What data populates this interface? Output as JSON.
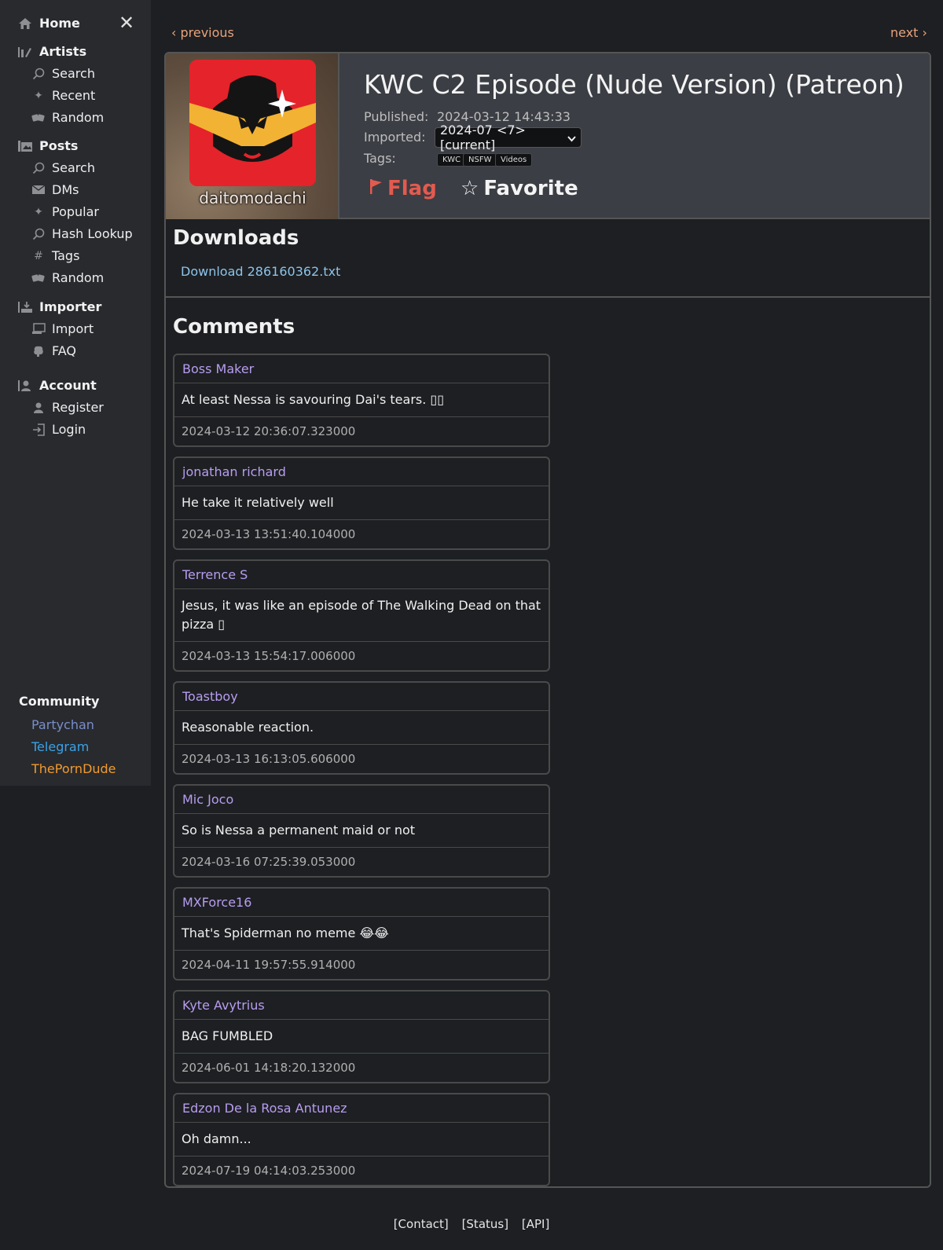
{
  "sidebar": {
    "home": "Home",
    "artists": {
      "label": "Artists",
      "items": [
        "Search",
        "Recent",
        "Random"
      ]
    },
    "posts": {
      "label": "Posts",
      "items": [
        "Search",
        "DMs",
        "Popular",
        "Hash Lookup",
        "Tags",
        "Random"
      ]
    },
    "importer": {
      "label": "Importer",
      "items": [
        "Import",
        "FAQ"
      ]
    },
    "account": {
      "label": "Account",
      "items": [
        "Register",
        "Login"
      ]
    },
    "community": {
      "label": "Community",
      "links": [
        {
          "label": "Partychan",
          "color": "#7a8ec9"
        },
        {
          "label": "Telegram",
          "color": "#3aa3e8"
        },
        {
          "label": "ThePornDude",
          "color": "#f29a2e"
        }
      ]
    }
  },
  "pager": {
    "previous": "‹ previous",
    "next": "next ›"
  },
  "post": {
    "artist": "daitomodachi",
    "title": "KWC C2 Episode (Nude Version) (Patreon)",
    "published_label": "Published:",
    "published_value": "2024-03-12 14:43:33",
    "imported_label": "Imported:",
    "imported_value": "2024-07 <7> [current]",
    "tags_label": "Tags:",
    "tags": [
      "KWC",
      "NSFW",
      "Videos"
    ],
    "flag_label": "Flag",
    "favorite_label": "Favorite"
  },
  "downloads": {
    "title": "Downloads",
    "link": "Download 286160362.txt"
  },
  "comments": {
    "title": "Comments",
    "items": [
      {
        "author": "Boss Maker",
        "text": "At least Nessa is savouring Dai's tears. ▯▯",
        "date": "2024-03-12 20:36:07.323000"
      },
      {
        "author": "jonathan richard",
        "text": "He take it relatively well",
        "date": "2024-03-13 13:51:40.104000"
      },
      {
        "author": "Terrence S",
        "text": "Jesus, it was like an episode of The Walking Dead on that pizza ▯",
        "date": "2024-03-13 15:54:17.006000"
      },
      {
        "author": "Toastboy",
        "text": "Reasonable reaction.",
        "date": "2024-03-13 16:13:05.606000"
      },
      {
        "author": "Mic Joco",
        "text": "So is Nessa a permanent maid or not",
        "date": "2024-03-16 07:25:39.053000"
      },
      {
        "author": "MXForce16",
        "text": "That's Spiderman no meme 😂😂",
        "date": "2024-04-11 19:57:55.914000"
      },
      {
        "author": "Kyte Avytrius",
        "text": "BAG FUMBLED",
        "date": "2024-06-01 14:18:20.132000"
      },
      {
        "author": "Edzon De la Rosa Antunez",
        "text": "Oh damn...",
        "date": "2024-07-19 04:14:03.253000"
      }
    ]
  },
  "footer": {
    "links": [
      "[Contact]",
      "[Status]",
      "[API]"
    ]
  }
}
